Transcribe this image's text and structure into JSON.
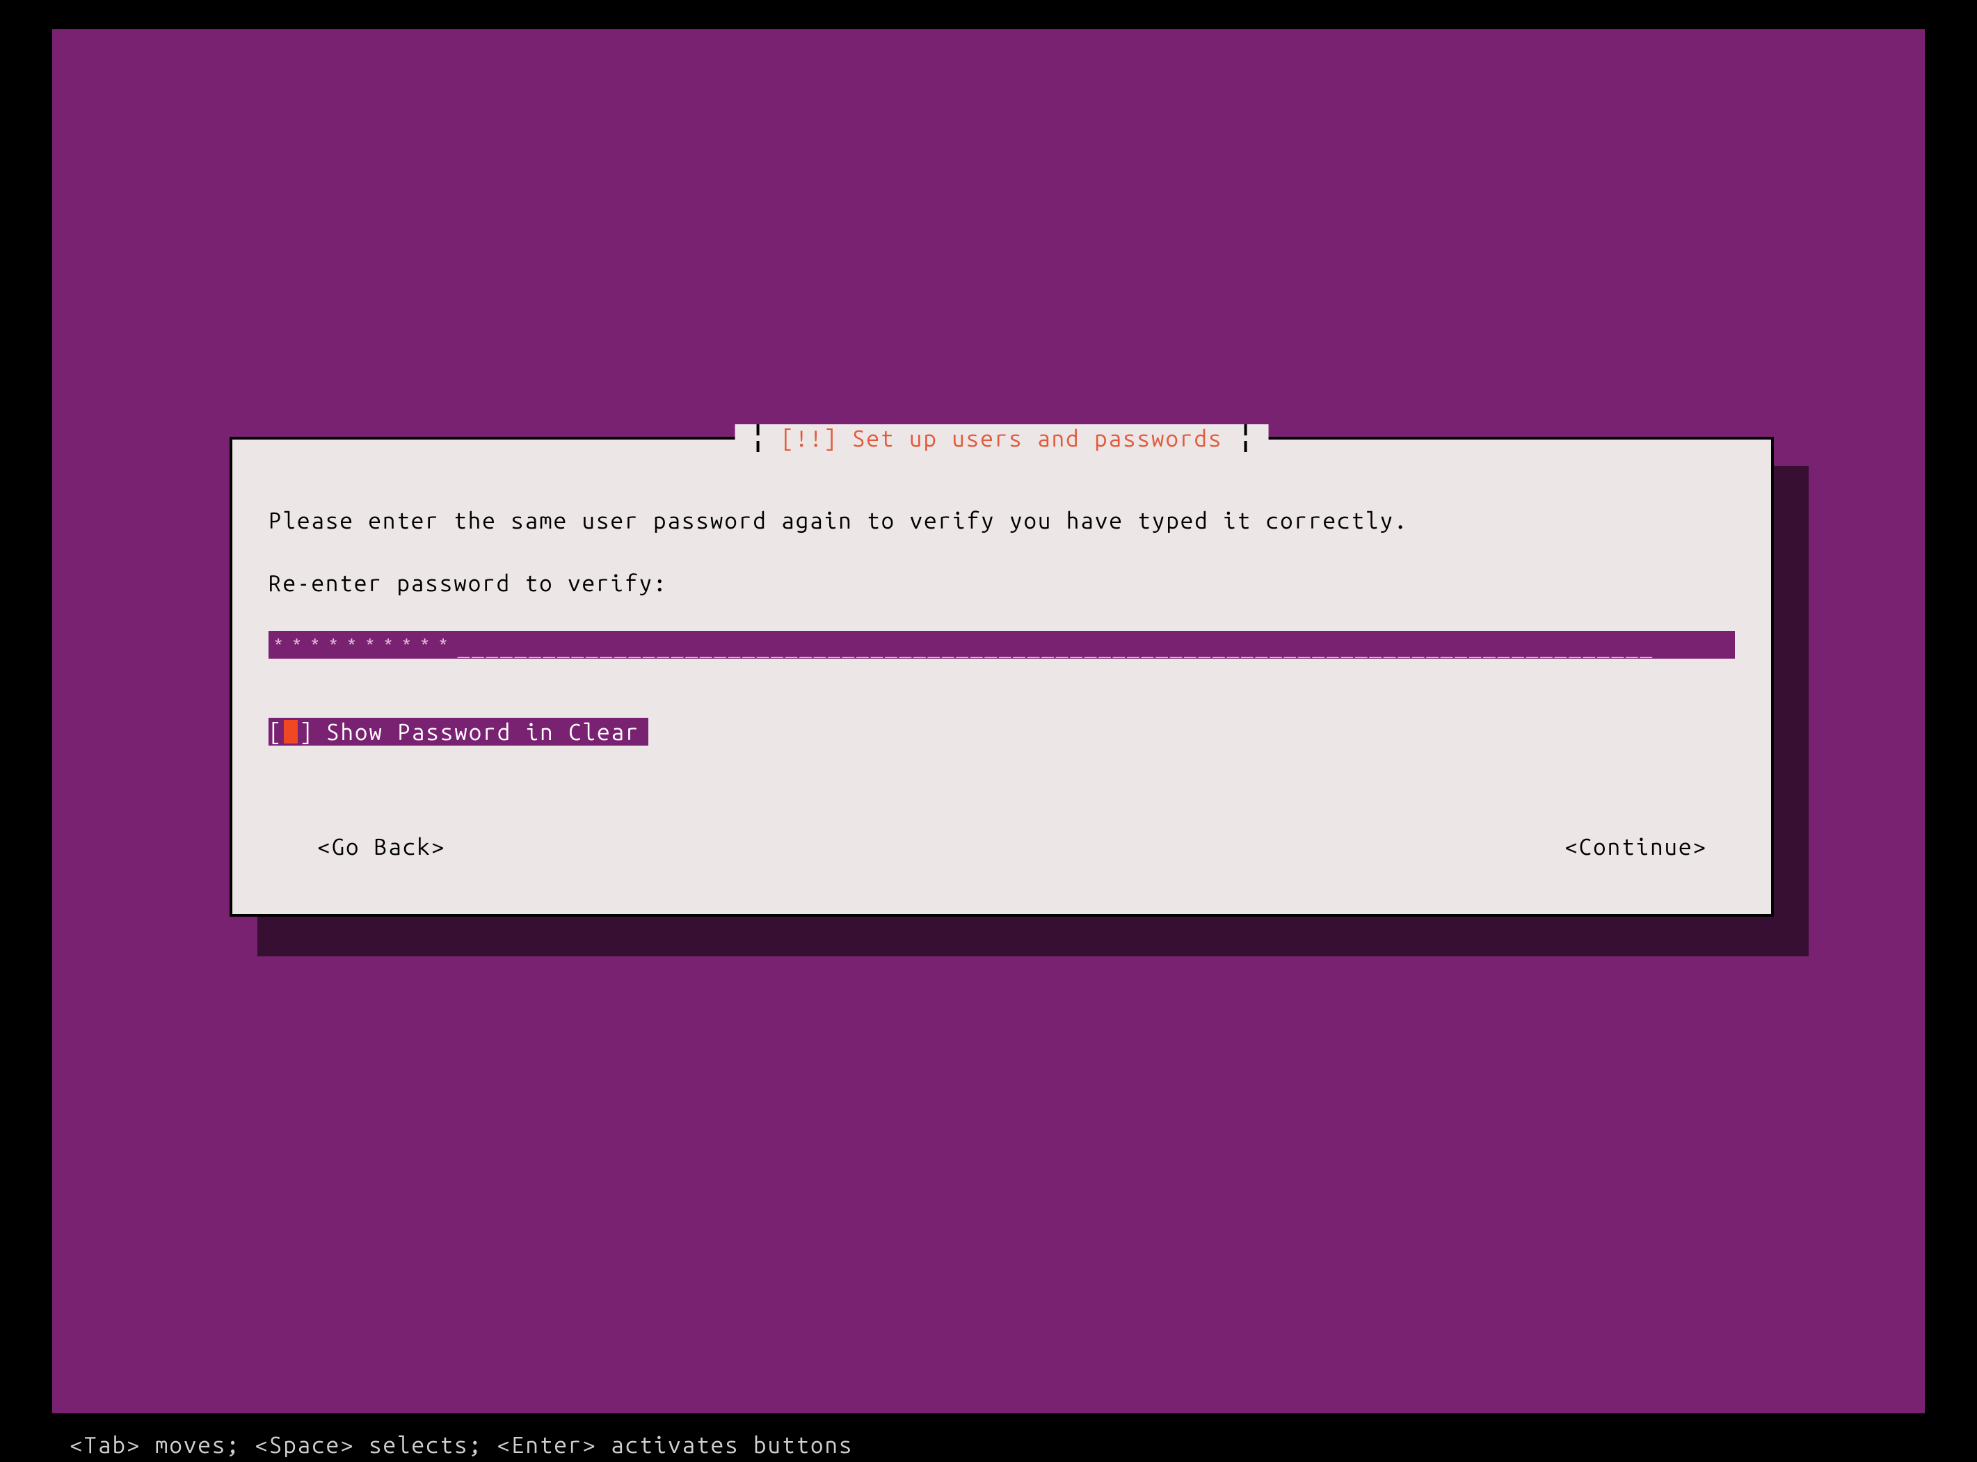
{
  "dialog": {
    "title": "[!!] Set up users and passwords",
    "instruction": "Please enter the same user password again to verify you have typed it correctly.",
    "field_label": "Re-enter password to verify:",
    "password_masked": "**********",
    "password_underline": "____________________________________________________________________________________",
    "checkbox": {
      "left_bracket": "[",
      "right_bracket": "]",
      "checked_char": " ",
      "label": "Show Password in Clear"
    },
    "buttons": {
      "back": "<Go Back>",
      "continue": "<Continue>"
    }
  },
  "hint": "<Tab> moves; <Space> selects; <Enter> activates buttons"
}
